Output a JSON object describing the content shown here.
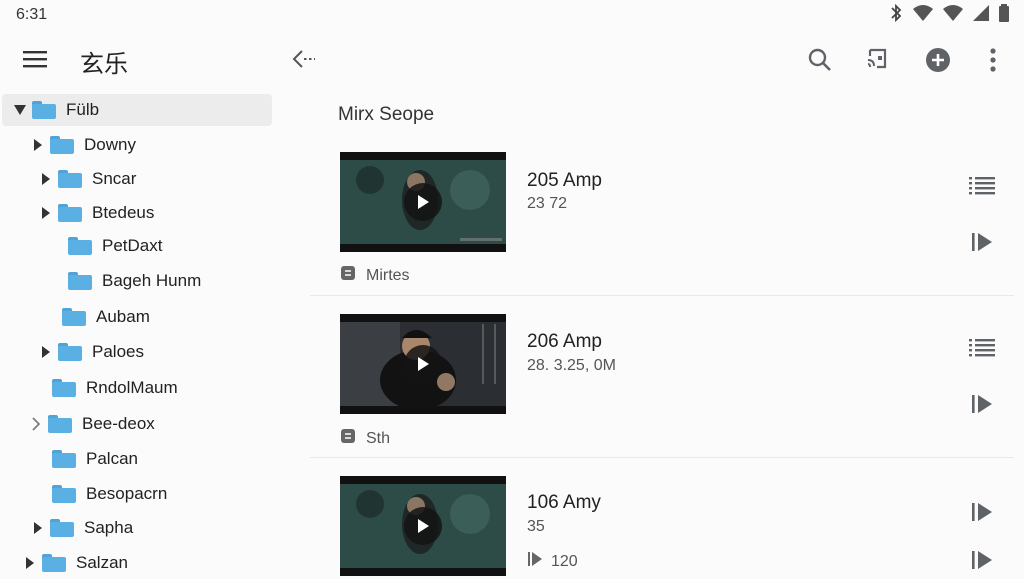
{
  "status": {
    "time": "6:31",
    "icons": [
      "bluetooth-icon",
      "wifi-icon",
      "signal-icon",
      "battery-icon"
    ]
  },
  "app_bar": {
    "title": "玄乐",
    "icons": {
      "menu": "hamburger-menu-icon",
      "collapse": "collapse-sidebar-icon",
      "search": "search-icon",
      "cast": "cast-icon",
      "add": "add-circle-icon",
      "more": "more-vert-icon"
    }
  },
  "sidebar": {
    "items": [
      {
        "label": "Fülb",
        "expanded": true
      },
      {
        "label": "Downy"
      },
      {
        "label": "Sncar"
      },
      {
        "label": "Btedeus"
      },
      {
        "label": "PetDaxt"
      },
      {
        "label": "Bageh Hunm"
      },
      {
        "label": "Aubam"
      },
      {
        "label": "Paloes"
      },
      {
        "label": "RndolMaum"
      },
      {
        "label": "Bee-deox"
      },
      {
        "label": "Palcan"
      },
      {
        "label": "Besopacrn"
      },
      {
        "label": "Sapha"
      },
      {
        "label": "Salzan"
      }
    ]
  },
  "main": {
    "section_title": "Mirx Seope",
    "cards": [
      {
        "title": "205 Amp",
        "subtitle": "23 72",
        "meta": "Mirtes"
      },
      {
        "title": "206 Amp",
        "subtitle": "28. 3.25, 0M",
        "meta": "Sth"
      },
      {
        "title": "106 Amy",
        "subtitle": "35",
        "meta": "120"
      }
    ]
  },
  "colors": {
    "folder": "#5ab0e2",
    "selected_bg": "#ececec",
    "icon": "#5f6368"
  }
}
